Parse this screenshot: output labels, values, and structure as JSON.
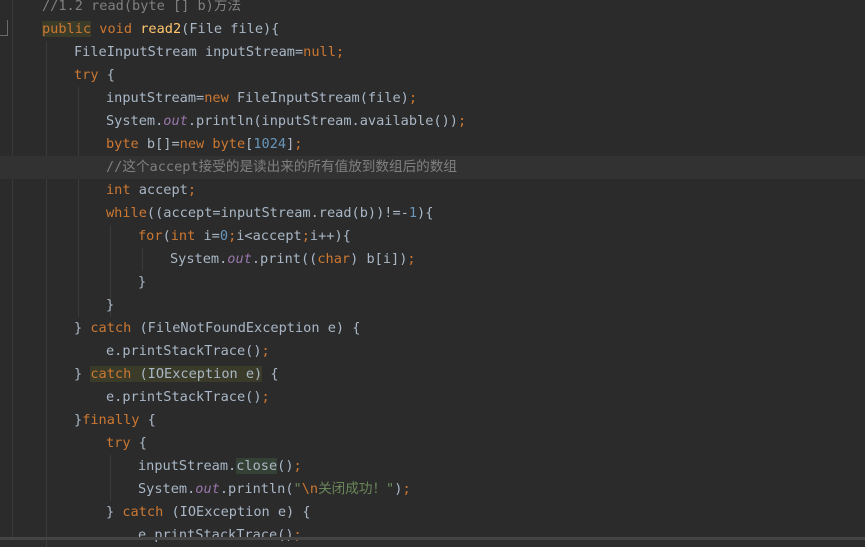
{
  "editor": {
    "lines": [
      {
        "indent": 42,
        "segs": [
          {
            "t": "//1.2 read(byte [] b)方法",
            "c": "cm"
          }
        ]
      },
      {
        "indent": 42,
        "segs": [
          {
            "t": "public",
            "c": "kw hl"
          },
          {
            "t": " ",
            "c": ""
          },
          {
            "t": "void",
            "c": "kw"
          },
          {
            "t": " ",
            "c": ""
          },
          {
            "t": "read2",
            "c": "fn"
          },
          {
            "t": "(File file){",
            "c": ""
          }
        ]
      },
      {
        "indent": 74,
        "segs": [
          {
            "t": "FileInputStream inputStream=",
            "c": ""
          },
          {
            "t": "null",
            "c": "kw"
          },
          {
            "t": ";",
            "c": "kw"
          }
        ]
      },
      {
        "indent": 74,
        "segs": [
          {
            "t": "try",
            "c": "kw"
          },
          {
            "t": " {",
            "c": ""
          }
        ]
      },
      {
        "indent": 106,
        "segs": [
          {
            "t": "inputStream=",
            "c": ""
          },
          {
            "t": "new",
            "c": "kw"
          },
          {
            "t": " FileInputStream(file)",
            "c": ""
          },
          {
            "t": ";",
            "c": "kw"
          }
        ]
      },
      {
        "indent": 106,
        "segs": [
          {
            "t": "System.",
            "c": ""
          },
          {
            "t": "out",
            "c": "fld"
          },
          {
            "t": ".println(inputStream.available())",
            "c": ""
          },
          {
            "t": ";",
            "c": "kw"
          }
        ]
      },
      {
        "indent": 106,
        "segs": [
          {
            "t": "byte",
            "c": "kw"
          },
          {
            "t": " b[]=",
            "c": ""
          },
          {
            "t": "new",
            "c": "kw"
          },
          {
            "t": " ",
            "c": ""
          },
          {
            "t": "byte",
            "c": "kw"
          },
          {
            "t": "[",
            "c": ""
          },
          {
            "t": "1024",
            "c": "num"
          },
          {
            "t": "]",
            "c": ""
          },
          {
            "t": ";",
            "c": "kw"
          }
        ]
      },
      {
        "indent": 106,
        "segs": [
          {
            "t": "//这个accept接受的是读出来的所有值放到数组后的数组",
            "c": "cm"
          }
        ],
        "caret": true
      },
      {
        "indent": 106,
        "segs": [
          {
            "t": "int",
            "c": "kw"
          },
          {
            "t": " accept",
            "c": ""
          },
          {
            "t": ";",
            "c": "kw"
          }
        ]
      },
      {
        "indent": 106,
        "segs": [
          {
            "t": "while",
            "c": "kw"
          },
          {
            "t": "((accept=inputStream.read(b))!=-",
            "c": ""
          },
          {
            "t": "1",
            "c": "num"
          },
          {
            "t": "){",
            "c": ""
          }
        ]
      },
      {
        "indent": 138,
        "segs": [
          {
            "t": "for",
            "c": "kw"
          },
          {
            "t": "(",
            "c": ""
          },
          {
            "t": "int",
            "c": "kw"
          },
          {
            "t": " i=",
            "c": ""
          },
          {
            "t": "0",
            "c": "num"
          },
          {
            "t": ";",
            "c": "kw"
          },
          {
            "t": "i<accept",
            "c": ""
          },
          {
            "t": ";",
            "c": "kw"
          },
          {
            "t": "i++){",
            "c": ""
          }
        ]
      },
      {
        "indent": 170,
        "segs": [
          {
            "t": "System.",
            "c": ""
          },
          {
            "t": "out",
            "c": "fld"
          },
          {
            "t": ".print((",
            "c": ""
          },
          {
            "t": "char",
            "c": "kw"
          },
          {
            "t": ") b[i])",
            "c": ""
          },
          {
            "t": ";",
            "c": "kw"
          }
        ]
      },
      {
        "indent": 138,
        "segs": [
          {
            "t": "}",
            "c": ""
          }
        ]
      },
      {
        "indent": 106,
        "segs": [
          {
            "t": "}",
            "c": ""
          }
        ]
      },
      {
        "indent": 74,
        "segs": [
          {
            "t": "} ",
            "c": ""
          },
          {
            "t": "catch",
            "c": "kw"
          },
          {
            "t": " (FileNotFoundException e) {",
            "c": ""
          }
        ]
      },
      {
        "indent": 106,
        "segs": [
          {
            "t": "e.printStackTrace()",
            "c": ""
          },
          {
            "t": ";",
            "c": "kw"
          }
        ]
      },
      {
        "indent": 74,
        "segs": [
          {
            "t": "} ",
            "c": ""
          },
          {
            "t": "catch",
            "c": "kw hl"
          },
          {
            "t": " (IOException e)",
            "c": "hl"
          },
          {
            "t": " {",
            "c": ""
          }
        ]
      },
      {
        "indent": 106,
        "segs": [
          {
            "t": "e.printStackTrace()",
            "c": ""
          },
          {
            "t": ";",
            "c": "kw"
          }
        ]
      },
      {
        "indent": 74,
        "segs": [
          {
            "t": "}",
            "c": ""
          },
          {
            "t": "finally",
            "c": "kw"
          },
          {
            "t": " {",
            "c": ""
          }
        ]
      },
      {
        "indent": 106,
        "segs": [
          {
            "t": "try",
            "c": "kw"
          },
          {
            "t": " {",
            "c": ""
          }
        ]
      },
      {
        "indent": 138,
        "segs": [
          {
            "t": "inputStream.",
            "c": ""
          },
          {
            "t": "close",
            "c": "hl2"
          },
          {
            "t": "()",
            "c": ""
          },
          {
            "t": ";",
            "c": "kw"
          }
        ]
      },
      {
        "indent": 138,
        "segs": [
          {
            "t": "System.",
            "c": ""
          },
          {
            "t": "out",
            "c": "fld"
          },
          {
            "t": ".println(",
            "c": ""
          },
          {
            "t": "\"",
            "c": "str"
          },
          {
            "t": "\\n",
            "c": "esc"
          },
          {
            "t": "关闭成功！\"",
            "c": "str"
          },
          {
            "t": ")",
            "c": ""
          },
          {
            "t": ";",
            "c": "kw"
          }
        ]
      },
      {
        "indent": 106,
        "segs": [
          {
            "t": "} ",
            "c": ""
          },
          {
            "t": "catch",
            "c": "kw"
          },
          {
            "t": " (IOException e) {",
            "c": ""
          }
        ]
      },
      {
        "indent": 138,
        "segs": [
          {
            "t": "e.printStackTrace()",
            "c": ""
          },
          {
            "t": ";",
            "c": "kw"
          }
        ]
      }
    ]
  }
}
